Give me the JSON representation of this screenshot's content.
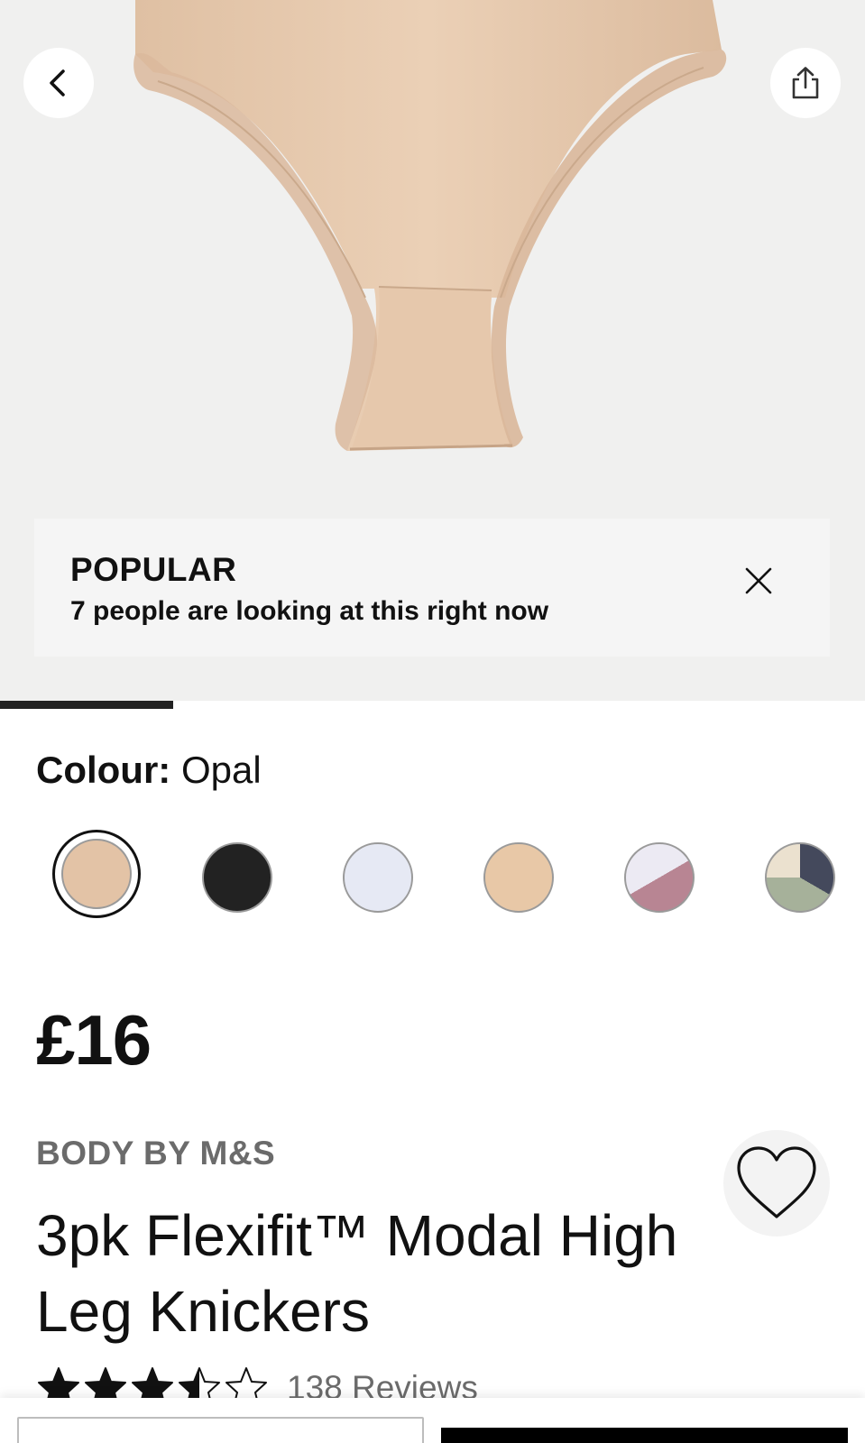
{
  "hero": {
    "popular": {
      "title": "POPULAR",
      "subtitle": "7 people are looking at this right now"
    },
    "gallery_progress": 0.2
  },
  "colour": {
    "label": "Colour:",
    "value": "Opal",
    "swatches": [
      {
        "name": "opal",
        "color": "#e3c3a6",
        "selected": true
      },
      {
        "name": "black",
        "color": "#222222"
      },
      {
        "name": "white",
        "color": "#e6e9f4"
      },
      {
        "name": "nude",
        "color": "#e8c8a7"
      },
      {
        "name": "white-pink-mix",
        "colors": [
          "#eceaf3",
          "#b88593"
        ]
      },
      {
        "name": "cream-sage-navy-mix",
        "colors": [
          "#ebe1cf",
          "#a6b19a",
          "#44495c"
        ]
      }
    ]
  },
  "product": {
    "price": "£16",
    "brand": "BODY BY M&S",
    "title": "3pk Flexifit™ Modal High Leg Knickers",
    "rating": 3.5,
    "reviews": "138 Reviews"
  },
  "icons": {
    "back": "chevron-left-icon",
    "share": "share-icon",
    "close": "close-icon",
    "wishlist": "heart-outline-icon"
  },
  "colors": {
    "product_fabric": "#e8ccb2",
    "hero_bg": "#f0f0ef",
    "text": "#111111",
    "muted": "#6b6b6b"
  }
}
